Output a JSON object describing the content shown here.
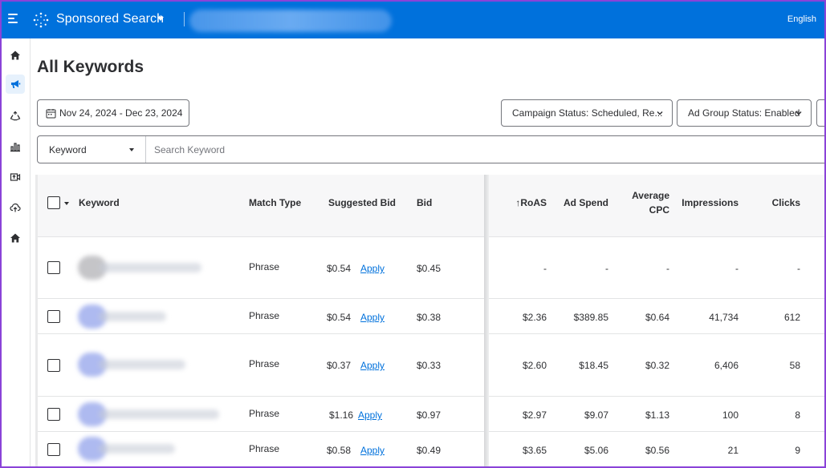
{
  "topbar": {
    "app_title": "Sponsored Search",
    "language": "English"
  },
  "page": {
    "title": "All Keywords"
  },
  "filters": {
    "date_range": "Nov 24, 2024 - Dec 23, 2024",
    "campaign_status": "Campaign Status: Scheduled, Re...",
    "ad_group_status": "Ad Group Status: Enabled"
  },
  "search": {
    "field_select": "Keyword",
    "placeholder": "Search Keyword"
  },
  "table": {
    "headers": {
      "keyword": "Keyword",
      "match_type": "Match Type",
      "suggested_bid": "Suggested Bid",
      "bid": "Bid",
      "roas": "↑RoAS",
      "ad_spend": "Ad Spend",
      "avg_cpc_line1": "Average",
      "avg_cpc_line2": "CPC",
      "impressions": "Impressions",
      "clicks": "Clicks"
    },
    "apply_label": "Apply",
    "rows": [
      {
        "match_type": "Phrase",
        "suggested_bid": "$0.54",
        "bid": "$0.45",
        "roas": "-",
        "ad_spend": "-",
        "avg_cpc": "-",
        "impressions": "-",
        "clicks": "-"
      },
      {
        "match_type": "Phrase",
        "suggested_bid": "$0.54",
        "bid": "$0.38",
        "roas": "$2.36",
        "ad_spend": "$389.85",
        "avg_cpc": "$0.64",
        "impressions": "41,734",
        "clicks": "612"
      },
      {
        "match_type": "Phrase",
        "suggested_bid": "$0.37",
        "bid": "$0.33",
        "roas": "$2.60",
        "ad_spend": "$18.45",
        "avg_cpc": "$0.32",
        "impressions": "6,406",
        "clicks": "58"
      },
      {
        "match_type": "Phrase",
        "suggested_bid": "$1.16",
        "bid": "$0.97",
        "roas": "$2.97",
        "ad_spend": "$9.07",
        "avg_cpc": "$1.13",
        "impressions": "100",
        "clicks": "8"
      },
      {
        "match_type": "Phrase",
        "suggested_bid": "$0.58",
        "bid": "$0.49",
        "roas": "$3.65",
        "ad_spend": "$5.06",
        "avg_cpc": "$0.56",
        "impressions": "21",
        "clicks": "9"
      }
    ]
  },
  "colors": {
    "brand_blue": "#0071dc",
    "text": "#2e2f32",
    "border": "#74767c",
    "frame": "#8a43d8"
  },
  "icons": {
    "menu": "hamburger-menu-icon",
    "logo": "spark-logo-icon",
    "nav": [
      "home-icon",
      "megaphone-icon",
      "recycle-icon",
      "bar-chart-icon",
      "video-upload-icon",
      "cloud-upload-icon",
      "home-icon"
    ],
    "calendar": "calendar-icon"
  }
}
